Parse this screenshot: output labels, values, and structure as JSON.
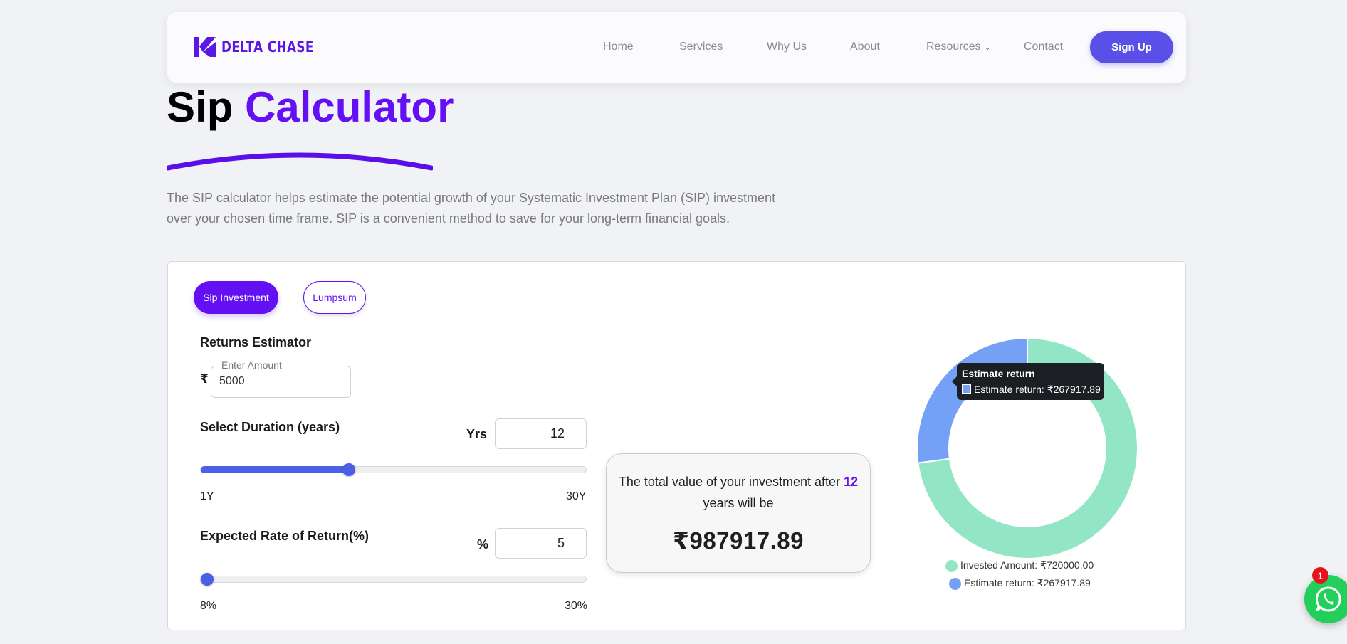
{
  "brand": {
    "name": "DELTA CHASE",
    "color": "#5b17e6"
  },
  "nav": {
    "items": [
      "Home",
      "Services",
      "Why Us",
      "About",
      "Resources",
      "Contact"
    ],
    "signup_label": "Sign Up"
  },
  "hero": {
    "title_part1": "Sip",
    "title_part2": "Calculator",
    "description": "The SIP calculator helps estimate the potential growth of your Systematic Investment Plan (SIP) investment over your chosen time frame. SIP is a convenient method to save for your long-term financial goals."
  },
  "tabs": {
    "sip": "Sip Investment",
    "lumpsum": "Lumpsum"
  },
  "calculator": {
    "section_title": "Returns Estimator",
    "currency_symbol": "₹",
    "amount_label": "Enter Amount",
    "amount_value": "5000",
    "duration": {
      "label": "Select Duration (years)",
      "unit": "Yrs",
      "value": "12",
      "min_label": "1Y",
      "max_label": "30Y",
      "min": 1,
      "max": 30,
      "current": 12
    },
    "rate": {
      "label": "Expected Rate of Return(%)",
      "unit": "%",
      "value": "5",
      "min_label": "8%",
      "max_label": "30%",
      "min": 8,
      "max": 30,
      "current": 8
    }
  },
  "result": {
    "text_before": "The total value of your investment after",
    "years": "12",
    "text_after": "years will be",
    "total_value": "₹987917.89"
  },
  "chart_data": {
    "type": "pie",
    "categories": [
      "Invested Amount",
      "Estimate return"
    ],
    "values": [
      720000.0,
      267917.89
    ],
    "colors": [
      "#92e6c6",
      "#74a0f5"
    ],
    "legend": [
      "Invested Amount: ₹720000.00",
      "Estimate return: ₹267917.89"
    ],
    "tooltip": {
      "title": "Estimate return",
      "body": "Estimate return: ₹267917.89"
    }
  },
  "whatsapp": {
    "badge": "1",
    "color": "#22cf5b"
  }
}
